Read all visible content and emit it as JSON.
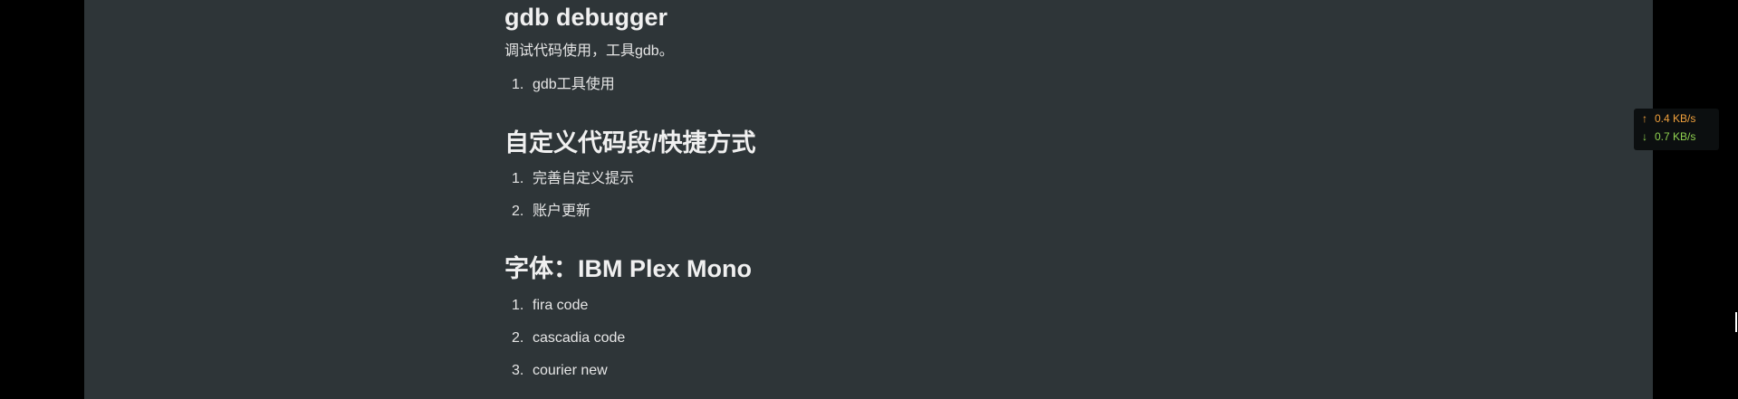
{
  "sections": [
    {
      "heading": "gdb debugger",
      "paragraph": "调试代码使用，工具gdb。",
      "items": [
        "gdb工具使用"
      ]
    },
    {
      "heading": "自定义代码段/快捷方式",
      "items": [
        "完善自定义提示",
        "账户更新"
      ]
    },
    {
      "heading": "字体：IBM Plex Mono",
      "items": [
        "fira code",
        "cascadia code",
        "courier new"
      ]
    }
  ],
  "list_numbers": [
    "1.",
    "2.",
    "3."
  ],
  "network_widget": {
    "upload_icon": "arrow-up-icon",
    "upload_speed": "0.4 KB/s",
    "download_icon": "arrow-down-icon",
    "download_speed": "0.7 KB/s",
    "upload_color": "#f0a03c",
    "download_color": "#8fd14f"
  },
  "colors": {
    "page_background": "#000000",
    "document_background": "#2e3538",
    "text": "#e6e6e6"
  }
}
